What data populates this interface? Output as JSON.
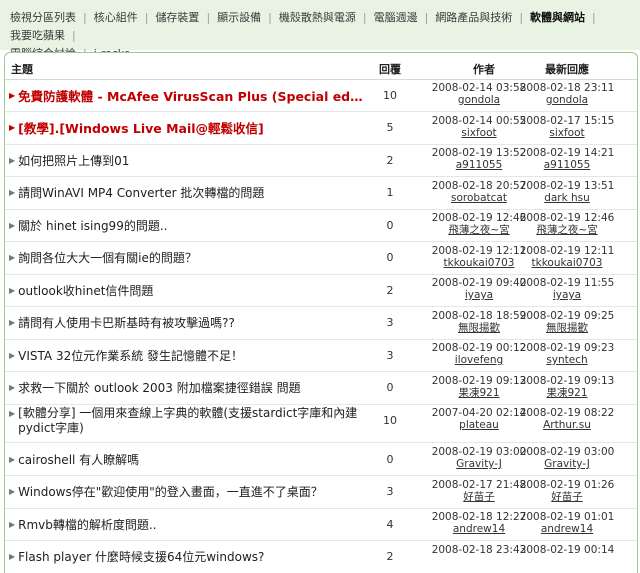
{
  "nav": {
    "line1": [
      "檢視分區列表",
      "核心組件",
      "儲存裝置",
      "顯示設備",
      "機殼散熱與電源",
      "電腦週邊",
      "網路產品與技術",
      "軟體與網站",
      "我要吃蘋果"
    ],
    "line2": [
      "電腦綜合討論",
      "i-rocks"
    ],
    "active": "軟體與網站"
  },
  "table": {
    "headers": {
      "subject": "主題",
      "replies": "回覆",
      "author": "作者",
      "last": "最新回應"
    },
    "rows": [
      {
        "title": "免費防護軟體 - McAfee VirusScan Plus (Special editi...",
        "hot": true,
        "replies": "10",
        "author_date": "2008-02-14 03:58",
        "author": "gondola",
        "last_date": "2008-02-18 23:11",
        "last_user": "gondola"
      },
      {
        "title": "[教學].[Windows Live Mail@輕鬆收信]",
        "hot": true,
        "replies": "5",
        "author_date": "2008-02-14 00:55",
        "author": "sixfoot",
        "last_date": "2008-02-17 15:15",
        "last_user": "sixfoot"
      },
      {
        "title": "如何把照片上傳到01",
        "replies": "2",
        "author_date": "2008-02-19 13:52",
        "author": "a911055",
        "last_date": "2008-02-19 14:21",
        "last_user": "a911055"
      },
      {
        "title": "請問WinAVI MP4 Converter 批次轉檔的問題",
        "replies": "1",
        "author_date": "2008-02-18 20:57",
        "author": "sorobatcat",
        "last_date": "2008-02-19 13:51",
        "last_user": "dark hsu"
      },
      {
        "title": "關於 hinet ising99的問題..",
        "replies": "0",
        "author_date": "2008-02-19 12:46",
        "author": "飛薄之夜~宮",
        "last_date": "2008-02-19 12:46",
        "last_user": "飛薄之夜~宮"
      },
      {
        "title": "詢問各位大大一個有關ie的問題？",
        "replies": "0",
        "author_date": "2008-02-19 12:11",
        "author": "tkkoukai0703",
        "last_date": "2008-02-19 12:11",
        "last_user": "tkkoukai0703"
      },
      {
        "title": "outlook收hinet信件問題",
        "replies": "2",
        "author_date": "2008-02-19 09:40",
        "author": "iyaya",
        "last_date": "2008-02-19 11:55",
        "last_user": "iyaya"
      },
      {
        "title": "請問有人使用卡巴斯基時有被攻擊過嗎??",
        "replies": "3",
        "author_date": "2008-02-18 18:59",
        "author": "無限揚歡",
        "last_date": "2008-02-19 09:25",
        "last_user": "無限揚歡"
      },
      {
        "title": "VISTA 32位元作業系統 發生記憶體不足！",
        "replies": "3",
        "author_date": "2008-02-19 00:12",
        "author": "ilovefeng",
        "last_date": "2008-02-19 09:23",
        "last_user": "syntech"
      },
      {
        "title": "求救一下關於 outlook 2003 附加檔案捷徑錯誤 問題",
        "replies": "0",
        "author_date": "2008-02-19 09:13",
        "author": "果凍921",
        "last_date": "2008-02-19 09:13",
        "last_user": "果凍921"
      },
      {
        "title": "[軟體分享] 一個用來查線上字典的軟體(支援stardict字庫和內建pydict字庫)",
        "replies": "10",
        "author_date": "2007-04-20 02:14",
        "author": "plateau",
        "last_date": "2008-02-19 08:22",
        "last_user": "Arthur.su",
        "two": true
      },
      {
        "title": "cairoshell 有人瞭解嗎",
        "replies": "0",
        "author_date": "2008-02-19 03:00",
        "author": "Gravity-J",
        "last_date": "2008-02-19 03:00",
        "last_user": "Gravity-J"
      },
      {
        "title": "Windows停在\"歡迎使用\"的登入畫面，一直進不了桌面？",
        "replies": "3",
        "author_date": "2008-02-17 21:48",
        "author": "好苗子",
        "last_date": "2008-02-19 01:26",
        "last_user": "好苗子"
      },
      {
        "title": "Rmvb轉檔的解析度問題..",
        "replies": "4",
        "author_date": "2008-02-18 12:27",
        "author": "andrew14",
        "last_date": "2008-02-19 01:01",
        "last_user": "andrew14"
      },
      {
        "title": "Flash player 什麼時候支援64位元windows?",
        "replies": "2",
        "author_date": "2008-02-18 23:43",
        "author": "",
        "last_date": "2008-02-19 00:14",
        "last_user": ""
      }
    ]
  }
}
